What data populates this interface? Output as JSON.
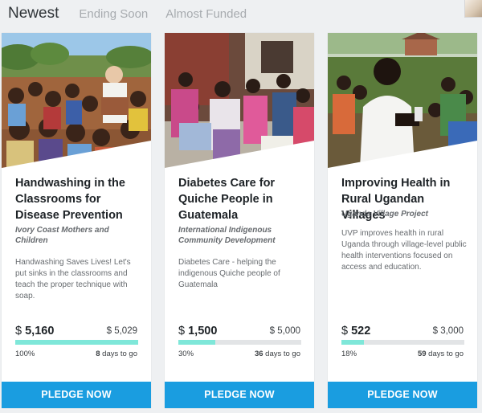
{
  "tabs": [
    {
      "label": "Newest",
      "active": true
    },
    {
      "label": "Ending Soon",
      "active": false
    },
    {
      "label": "Almost Funded",
      "active": false
    }
  ],
  "colors": {
    "accent": "#1a9de0",
    "progress": "#7fe7d9",
    "track": "#e2e4e6"
  },
  "projects": [
    {
      "title": "Handwashing in the Classrooms for Disease Prevention",
      "organization": "Ivory Coast Mothers and Children",
      "description": "Handwashing Saves Lives! Let's put sinks in the classrooms and teach the proper technique with soap.",
      "currency": "$",
      "raised": "5,160",
      "goal": "$ 5,029",
      "percent_label": "100%",
      "progress_fraction": 1.0,
      "days_number": "8",
      "days_text": "days to go",
      "pledge_label": "PLEDGE NOW"
    },
    {
      "title": "Diabetes Care for Quiche People in Guatemala",
      "organization": "International Indigenous Community Development",
      "description": "Diabetes Care - helping the indigenous Quiche people of Guatemala",
      "currency": "$",
      "raised": "1,500",
      "goal": "$ 5,000",
      "percent_label": "30%",
      "progress_fraction": 0.3,
      "days_number": "36",
      "days_text": "days to go",
      "pledge_label": "PLEDGE NOW"
    },
    {
      "title": "Improving Health in Rural Ugandan Villages",
      "organization": "Uganda Village Project",
      "description": "UVP improves health in rural Uganda through village-level public health interventions focused on access and education.",
      "currency": "$",
      "raised": "522",
      "goal": "$ 3,000",
      "percent_label": "18%",
      "progress_fraction": 0.18,
      "days_number": "59",
      "days_text": "days to go",
      "pledge_label": "PLEDGE NOW"
    }
  ]
}
